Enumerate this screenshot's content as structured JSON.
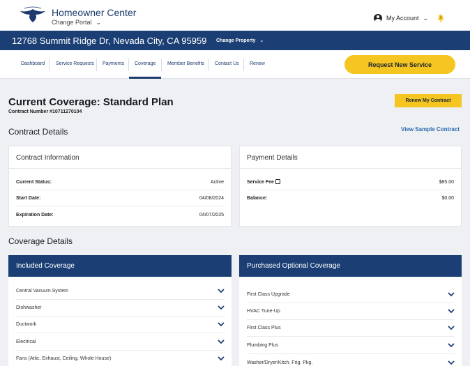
{
  "header": {
    "brand_title": "Homeowner Center",
    "change_portal": "Change Portal",
    "account_label": "My Account"
  },
  "address_bar": {
    "address": "12768 Summit Ridge Dr, Nevada City, CA 95959",
    "change_property": "Change Property"
  },
  "nav": {
    "items": [
      "Dashboard",
      "Service Requests",
      "Payments",
      "Coverage",
      "Member Benefits",
      "Contact Us",
      "Renew"
    ],
    "active": "Coverage",
    "request_button": "Request New Service"
  },
  "page": {
    "title": "Current Coverage: Standard Plan",
    "contract_number": "Contract Number #10711270104",
    "renew_button": "Renew My Contract",
    "contract_details_title": "Contract Details",
    "view_sample": "View Sample Contract",
    "coverage_details_title": "Coverage Details"
  },
  "contract_info": {
    "title": "Contract Information",
    "rows": [
      {
        "label": "Current Status:",
        "value": "Active"
      },
      {
        "label": "Start Date:",
        "value": "04/08/2024"
      },
      {
        "label": "Expiration Date:",
        "value": "04/07/2025"
      }
    ]
  },
  "payment_details": {
    "title": "Payment Details",
    "rows": [
      {
        "label": "Service Fee",
        "value": "$85.00"
      },
      {
        "label": "Balance:",
        "value": "$0.00"
      }
    ]
  },
  "included_coverage": {
    "title": "Included Coverage",
    "items": [
      "Central Vacuum System",
      "Dishwasher",
      "Ductwork",
      "Electrical",
      "Fans (Attic, Exhaust, Ceiling, Whole House)"
    ]
  },
  "optional_coverage": {
    "title": "Purchased Optional Coverage",
    "items": [
      "First Class Upgrade",
      "HVAC Tune-Up",
      "First Class Plus",
      "Plumbing Plus",
      "Washer/Dryer/Kitch. Frig. Pkg."
    ]
  },
  "colors": {
    "navy": "#1b3f74",
    "accent_yellow": "#f5c521",
    "link_blue": "#2a6aad"
  }
}
